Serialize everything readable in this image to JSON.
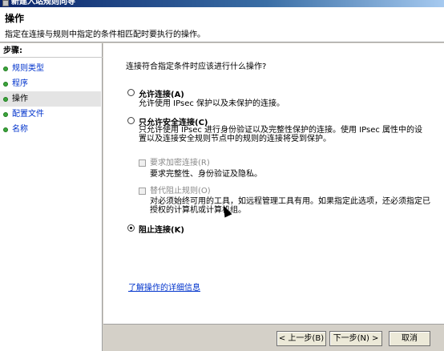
{
  "window": {
    "title": "新建入站规则向导"
  },
  "header": {
    "title": "操作",
    "description": "指定在连接与规则中指定的条件相匹配时要执行的操作。"
  },
  "steps": {
    "heading": "步骤:",
    "items": [
      {
        "label": "规则类型"
      },
      {
        "label": "程序"
      },
      {
        "label": "操作"
      },
      {
        "label": "配置文件"
      },
      {
        "label": "名称"
      }
    ]
  },
  "main": {
    "question": "连接符合指定条件时应该进行什么操作?",
    "options": [
      {
        "label": "允许连接(A)",
        "description": "允许使用 IPsec 保护以及未保护的连接。"
      },
      {
        "label": "只允许安全连接(C)",
        "description_line1": "只允许使用 IPsec 进行身份验证以及完整性保护的连接。使用 IPsec 属性中的设",
        "description_line2": "置以及连接安全规则节点中的规则的连接将受到保护。",
        "sub_options": [
          {
            "label": "要求加密连接(R)",
            "description": "要求完整性、身份验证及隐私。"
          },
          {
            "label": "替代阻止规则(O)",
            "description_line1": "对必须始终可用的工具，如远程管理工具有用。如果指定此选项，还必须指定已",
            "description_line2": "授权的计算机或计算机组。"
          }
        ]
      },
      {
        "label": "阻止连接(K)"
      }
    ],
    "help_link": "了解操作的详细信息"
  },
  "buttons": {
    "back": "< 上一步(B)",
    "next": "下一步(N) >",
    "cancel": "取消"
  },
  "colors": {
    "link": "#0033cc",
    "step_dot": "#3ca63c",
    "title_bar": "#0a246a"
  }
}
